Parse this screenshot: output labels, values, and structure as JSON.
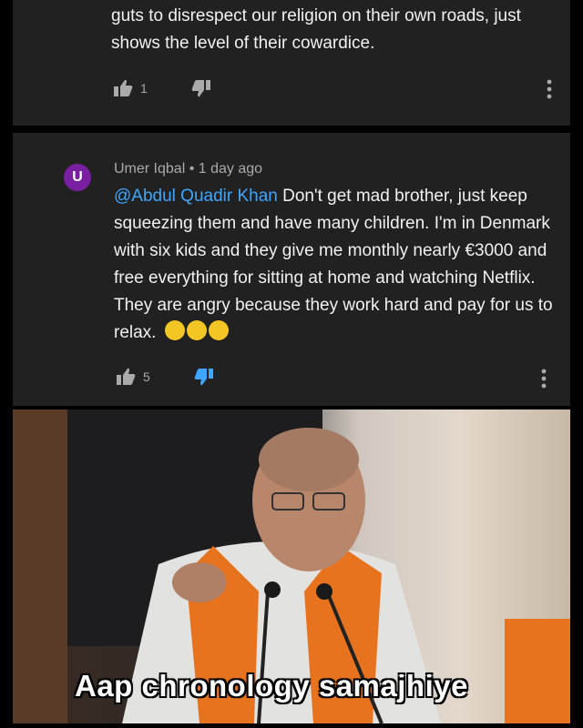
{
  "comment_prev": {
    "text": "guts to disrespect our religion on their own roads, just shows the level of their cowardice.",
    "like_count": "1"
  },
  "comment_main": {
    "avatar_letter": "U",
    "author": "Umer Iqbal",
    "separator": "•",
    "time": "1 day ago",
    "mention": "@Abdul Quadir Khan",
    "text": "Don't get mad brother, just keep squeezing them and have many children. I'm in Denmark with six kids and they give me monthly nearly €3000 and free everything for sitting at home and watching Netflix. They are angry because they work hard and pay for us to relax.",
    "like_count": "5",
    "emoji": "laughing-emoji"
  },
  "meme": {
    "caption": "Aap chronology samajhiye"
  },
  "colors": {
    "card_bg": "#212121",
    "page_bg": "#000000",
    "mention": "#3ea6ff",
    "avatar": "#7b1fa2",
    "muted": "#aaaaaa"
  }
}
